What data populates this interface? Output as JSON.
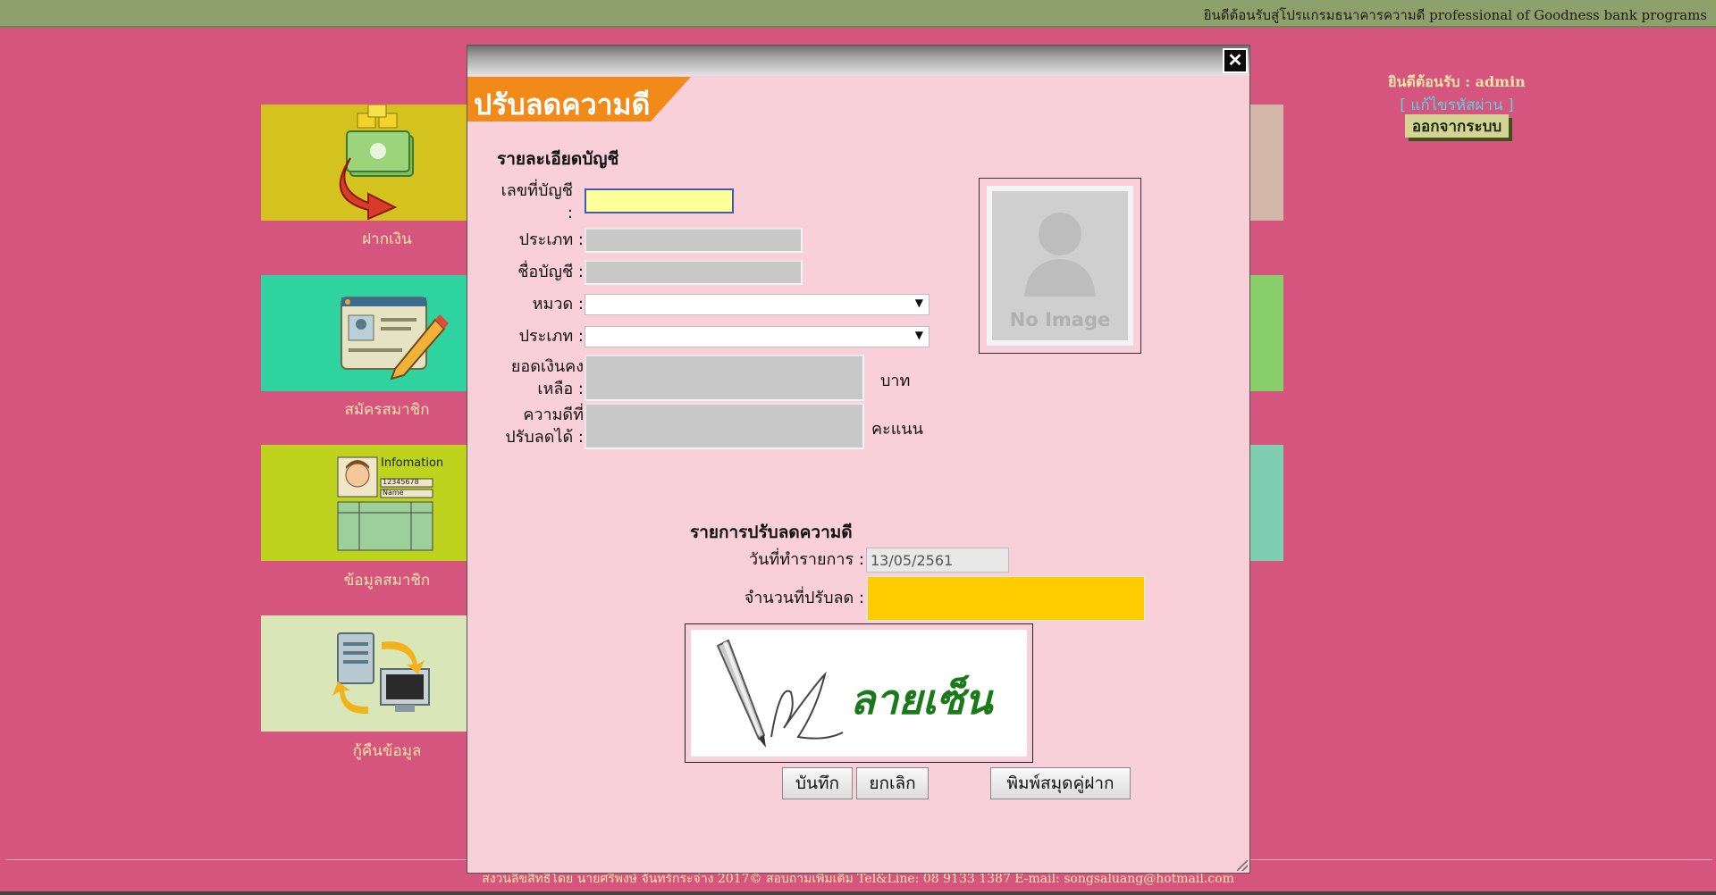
{
  "topbar": {
    "welcome_text": "ยินดีต้อนรับสู่โปรแกรมธนาคารความดี professional of Goodness bank programs"
  },
  "menu": {
    "tiles": [
      {
        "label": "ฝากเงิน",
        "color": "#d4c21e"
      },
      {
        "label": "สมัครสมาชิก",
        "color": "#2fd3a0"
      },
      {
        "label": "ข้อมูลสมาชิก",
        "color": "#bdd31e"
      },
      {
        "label": "กู้คืนข้อมูล",
        "color": "#d9e6b8"
      }
    ],
    "info_card": {
      "title": "Infomation",
      "number": "12345678",
      "name": "Name"
    }
  },
  "user_panel": {
    "greeting_prefix": "ยินดีต้อนรับ : ",
    "username": "admin",
    "change_password": "[ แก้ไขรหัสผ่าน ]",
    "logout": "ออกจากระบบ"
  },
  "footer": {
    "text": "สงวนลิขสิทธิ์โดย นายศรีพงษ์ จันทร์กระจ่าง 2017© สอบถามเพิ่มเติม Tel&Line: 08 9133 1387 E-mail: songsaluang@hotmail.com"
  },
  "modal": {
    "close_symbol": "✕",
    "header": "ปรับลดความดี",
    "account_section": {
      "title": "รายละเอียดบัญชี",
      "fields": {
        "account_no": {
          "label": "เลขที่บัญชี :",
          "value": ""
        },
        "type": {
          "label": "ประเภท :",
          "value": ""
        },
        "account_name": {
          "label": "ชื่อบัญชี :",
          "value": ""
        },
        "category": {
          "label": "หมวด :",
          "selected": ""
        },
        "subtype": {
          "label": "ประเภท :",
          "selected": ""
        },
        "balance": {
          "label": "ยอดเงินคงเหลือ :",
          "unit": "บาท",
          "value": ""
        },
        "reducible_points": {
          "label": "ความดีที่ปรับลดได้ :",
          "unit": "คะแนน",
          "value": ""
        }
      },
      "photo_placeholder": "No Image"
    },
    "reduce_section": {
      "title": "รายการปรับลดความดี",
      "fields": {
        "date": {
          "label": "วันที่ทำรายการ :",
          "value": "13/05/2561"
        },
        "amount": {
          "label": "จำนวนที่ปรับลด :",
          "value": ""
        }
      },
      "signature_text": "ลายเซ็น"
    },
    "buttons": {
      "save": "บันทึก",
      "cancel": "ยกเลิก",
      "print": "พิมพ์สมุดคู่ฝาก"
    }
  },
  "colors": {
    "background": "#d5557f",
    "modal_bg": "#f9d0d9",
    "header_orange": "#f28a1a",
    "amount_yellow": "#ffcc00",
    "account_yellow": "#ffff99"
  }
}
